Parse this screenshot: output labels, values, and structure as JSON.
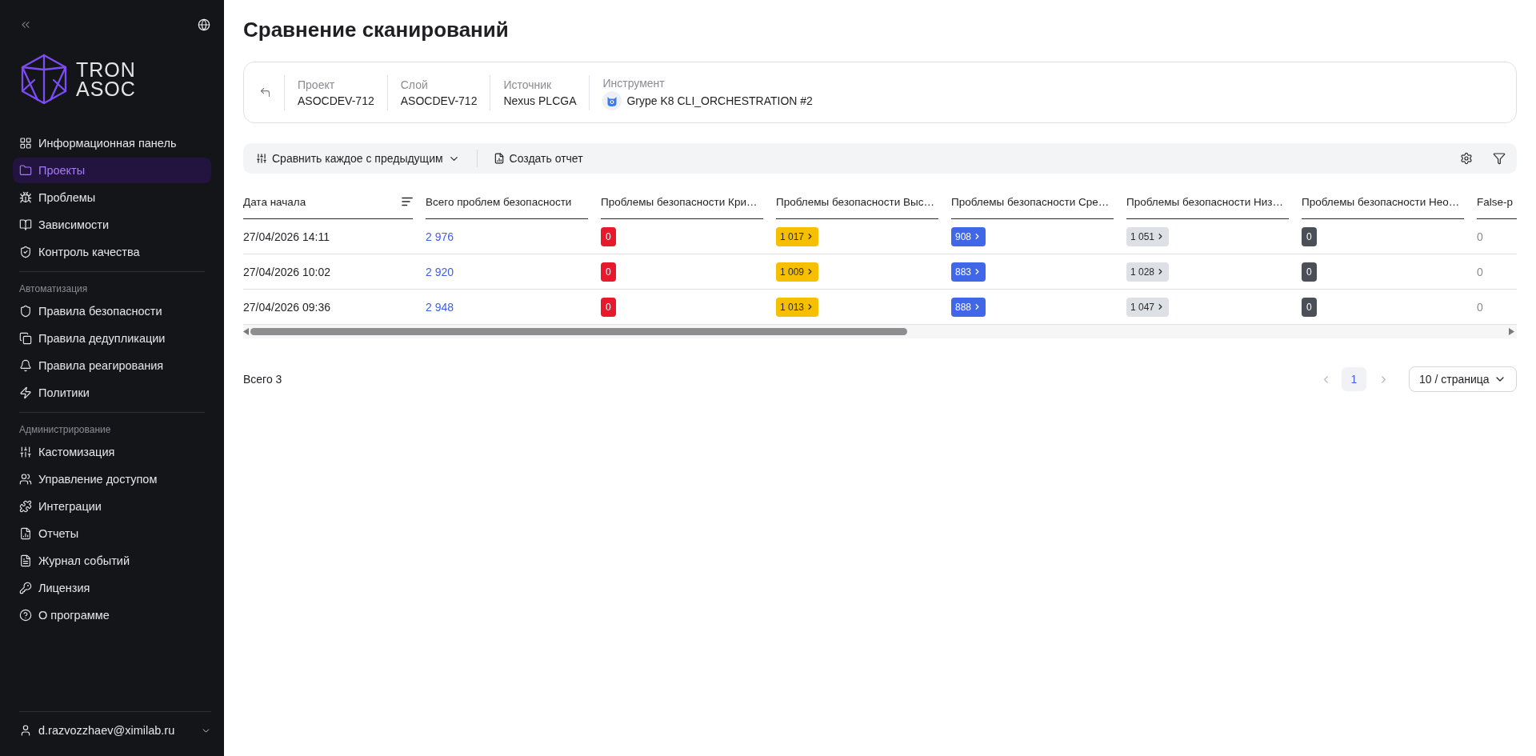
{
  "sidebar": {
    "logo": {
      "lines": [
        "TRON",
        "ASOC"
      ]
    },
    "sections": [
      {
        "items": [
          {
            "label": "Информационная панель",
            "selected": false
          },
          {
            "label": "Проекты",
            "selected": true
          },
          {
            "label": "Проблемы",
            "selected": false
          },
          {
            "label": "Зависимости",
            "selected": false
          },
          {
            "label": "Контроль качества",
            "selected": false
          }
        ]
      },
      {
        "title": "Автоматизация",
        "items": [
          {
            "label": "Правила безопасности",
            "selected": false
          },
          {
            "label": "Правила дедупликации",
            "selected": false
          },
          {
            "label": "Правила реагирования",
            "selected": false
          },
          {
            "label": "Политики",
            "selected": false
          }
        ]
      },
      {
        "title": "Администрирование",
        "items": [
          {
            "label": "Кастомизация",
            "selected": false
          },
          {
            "label": "Управление доступом",
            "selected": false
          },
          {
            "label": "Интеграции",
            "selected": false
          },
          {
            "label": "Отчеты",
            "selected": false
          },
          {
            "label": "Журнал событий",
            "selected": false
          },
          {
            "label": "Лицензия",
            "selected": false
          },
          {
            "label": "О программе",
            "selected": false
          }
        ]
      }
    ],
    "user": {
      "email": "d.razvozzhaev@ximilab.ru"
    }
  },
  "page": {
    "title": "Сравнение сканирований"
  },
  "scan_info": {
    "fields": [
      {
        "kind": "text",
        "label": "Проект",
        "value": "ASOCDEV-712"
      },
      {
        "kind": "text",
        "label": "Слой",
        "value": "ASOCDEV-712"
      },
      {
        "kind": "text",
        "label": "Источник",
        "value": "Nexus PLCGA"
      },
      {
        "kind": "tool",
        "label": "Инструмент",
        "value": "Grype K8 CLI_ORCHESTRATION #2"
      }
    ]
  },
  "toolbar": {
    "compare_mode": "Сравнить каждое с предыдущим",
    "create_report": "Создать отчет"
  },
  "table": {
    "columns": [
      {
        "label": "Дата начала",
        "sortable": true
      },
      {
        "label": "Всего проблем безопасности",
        "sortable": false
      },
      {
        "label": "Проблемы безопасности Кри…",
        "sortable": false
      },
      {
        "label": "Проблемы безопасности Выс…",
        "sortable": false
      },
      {
        "label": "Проблемы безопасности Сре…",
        "sortable": false
      },
      {
        "label": "Проблемы безопасности Низ…",
        "sortable": false
      },
      {
        "label": "Проблемы безопасности Нео…",
        "sortable": false
      },
      {
        "label": "False-p",
        "sortable": false
      }
    ],
    "rows": [
      {
        "cells": [
          {
            "kind": "text",
            "text": "27/04/2026 14:11"
          },
          {
            "kind": "link",
            "text": "2 976"
          },
          {
            "kind": "badge",
            "text": "0",
            "color": "#e8192c",
            "drilldown": false
          },
          {
            "kind": "badge",
            "text": "1 017",
            "color": "#f6c000",
            "drilldown": true
          },
          {
            "kind": "badge",
            "text": "908",
            "color": "#3f67e8",
            "drilldown": true
          },
          {
            "kind": "badge",
            "text": "1 051",
            "color": "#dde0e5",
            "drilldown": true
          },
          {
            "kind": "badge",
            "text": "0",
            "color": "#4b4f58",
            "drilldown": false
          },
          {
            "kind": "muted",
            "text": "0"
          }
        ]
      },
      {
        "cells": [
          {
            "kind": "text",
            "text": "27/04/2026 10:02"
          },
          {
            "kind": "link",
            "text": "2 920"
          },
          {
            "kind": "badge",
            "text": "0",
            "color": "#e8192c",
            "drilldown": false
          },
          {
            "kind": "badge",
            "text": "1 009",
            "color": "#f6c000",
            "drilldown": true
          },
          {
            "kind": "badge",
            "text": "883",
            "color": "#3f67e8",
            "drilldown": true
          },
          {
            "kind": "badge",
            "text": "1 028",
            "color": "#dde0e5",
            "drilldown": true
          },
          {
            "kind": "badge",
            "text": "0",
            "color": "#4b4f58",
            "drilldown": false
          },
          {
            "kind": "muted",
            "text": "0"
          }
        ]
      },
      {
        "cells": [
          {
            "kind": "text",
            "text": "27/04/2026 09:36"
          },
          {
            "kind": "link",
            "text": "2 948"
          },
          {
            "kind": "badge",
            "text": "0",
            "color": "#e8192c",
            "drilldown": false
          },
          {
            "kind": "badge",
            "text": "1 013",
            "color": "#f6c000",
            "drilldown": true
          },
          {
            "kind": "badge",
            "text": "888",
            "color": "#3f67e8",
            "drilldown": true
          },
          {
            "kind": "badge",
            "text": "1 047",
            "color": "#dde0e5",
            "drilldown": true
          },
          {
            "kind": "badge",
            "text": "0",
            "color": "#4b4f58",
            "drilldown": false
          },
          {
            "kind": "muted",
            "text": "0"
          }
        ]
      }
    ]
  },
  "footer": {
    "total": "Всего 3",
    "previous": {
      "disabled": true
    },
    "pages": [
      {
        "label": "1",
        "selected": true
      }
    ],
    "next": {
      "disabled": true
    },
    "page_size": "10 / страница"
  }
}
